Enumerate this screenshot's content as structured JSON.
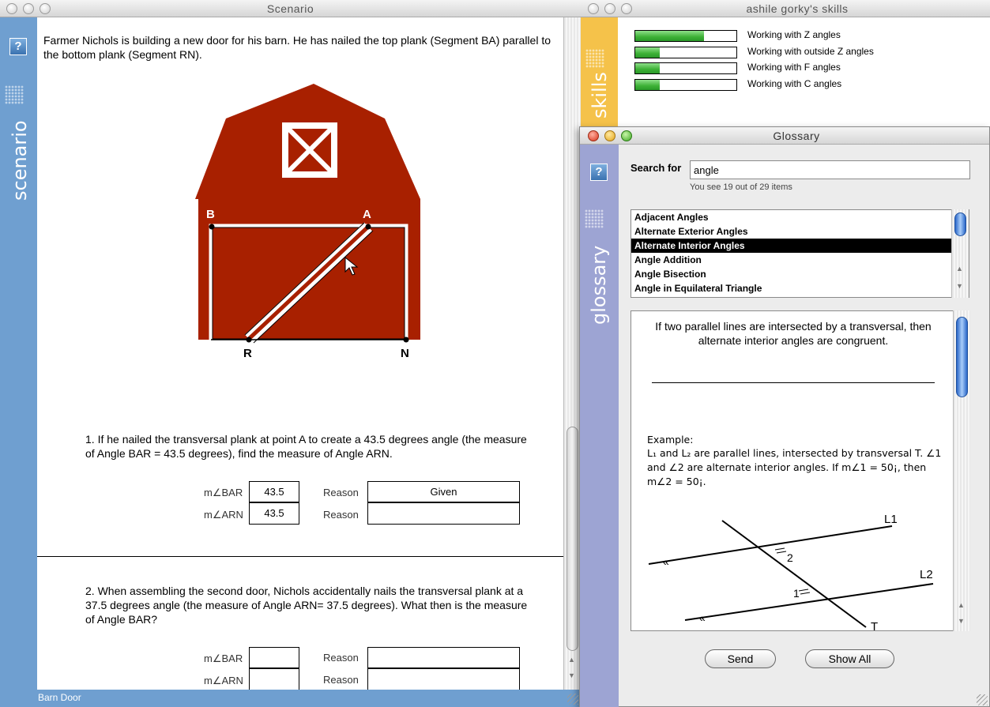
{
  "scenario": {
    "title": "Scenario",
    "side_label": "scenario",
    "help_label": "?",
    "intro": "Farmer Nichols is building a new door for his barn. He has nailed the top plank (Segment BA) parallel to the bottom plank (Segment RN).",
    "points": {
      "b": "B",
      "a": "A",
      "r": "R",
      "n": "N"
    },
    "q1": {
      "text": "1. If he nailed the transversal plank at point A to create a 43.5 degrees angle (the measure of Angle BAR = 43.5 degrees), find the measure of Angle ARN.",
      "rows": [
        {
          "label": "m∠BAR",
          "value": "43.5",
          "reason_label": "Reason",
          "reason": "Given"
        },
        {
          "label": "m∠ARN",
          "value": "43.5",
          "reason_label": "Reason",
          "reason": ""
        }
      ]
    },
    "q2": {
      "text": "2. When assembling the second door, Nichols accidentally nails the transversal plank at a 37.5 degrees angle (the measure of Angle ARN= 37.5 degrees). What then is the measure of Angle BAR?",
      "rows": [
        {
          "label": "m∠BAR",
          "value": "",
          "reason_label": "Reason",
          "reason": ""
        },
        {
          "label": "m∠ARN",
          "value": "",
          "reason_label": "Reason",
          "reason": ""
        }
      ]
    },
    "status": "Barn Door",
    "colors": {
      "sidebar": "#6f9fd0",
      "barn": "#a82000"
    }
  },
  "skills": {
    "title": "ashile gorky's skills",
    "side_label": "skills",
    "items": [
      {
        "label": "Working with Z angles",
        "level": 0.68
      },
      {
        "label": "Working with outside Z angles",
        "level": 0.24
      },
      {
        "label": "Working with F angles",
        "level": 0.24
      },
      {
        "label": "Working with C angles",
        "level": 0.24
      }
    ],
    "colors": {
      "sidebar": "#f5c24a",
      "bar": "#3cb035"
    }
  },
  "glossary": {
    "title": "Glossary",
    "side_label": "glossary",
    "help_label": "?",
    "search_label": "Search for",
    "search_value": "angle",
    "count_text": "You see 19 out of 29 items",
    "items": [
      "Adjacent Angles",
      "Alternate Exterior Angles",
      "Alternate Interior Angles",
      "Angle Addition",
      "Angle Bisection",
      "Angle in Equilateral Triangle"
    ],
    "selected_item": "Alternate Interior Angles",
    "definition": "If two parallel lines are intersected by a transversal, then alternate interior angles are congruent.",
    "example_title": "Example:",
    "example_text": "L₁ and L₂ are parallel lines, intersected by transversal T. ∠1 and ∠2 are alternate interior angles. If m∠1 = 50¡, then m∠2 = 50¡.",
    "diagram_labels": {
      "l1": "L1",
      "l2": "L2",
      "t": "T",
      "a1": "1",
      "a2": "2"
    },
    "send_label": "Send",
    "show_all_label": "Show All",
    "colors": {
      "sidebar": "#9da4d3",
      "thumb": "#2a67c8"
    }
  }
}
